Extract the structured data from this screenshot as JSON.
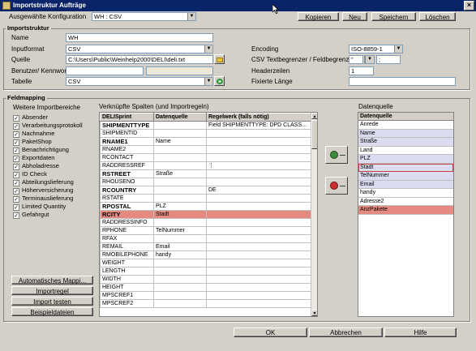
{
  "window": {
    "title": "Importstruktur Aufträge",
    "close_glyph": "×"
  },
  "top": {
    "config_label": "Ausgewählte Konfiguration",
    "config_value": "WH : CSV",
    "btn_copy": "Kopieren",
    "btn_new": "Neu",
    "btn_save": "Speichern",
    "btn_delete": "Löschen"
  },
  "importstruktur": {
    "group_label": "Importstruktur",
    "name_label": "Name",
    "name_value": "WH",
    "format_label": "Inputformat",
    "format_value": "CSV",
    "source_label": "Quelle",
    "source_value": "C:\\Users\\Public\\Weinhelp2000\\DELI\\deli.txt",
    "user_label": "Benutzer/ Kennwort",
    "user_value": "",
    "password_value": "",
    "table_label": "Tabelle",
    "table_value": "CSV",
    "encoding_label": "Encoding",
    "encoding_value": "ISO-8859-1",
    "delim_label": "CSV Textbegrenzer / Feldbegrenzer",
    "delim_text_value": "\"",
    "delim_field_value": ";",
    "header_label": "Headerzeilen",
    "header_value": "1",
    "fixed_label": "Fixierte Länge",
    "fixed_value": ""
  },
  "feldmapping": {
    "group_label": "Feldmapping",
    "further_label": "Weitere Importbereiche",
    "checkboxes": [
      {
        "label": "Absender",
        "checked": true
      },
      {
        "label": "Verarbeitungsprotokoll",
        "checked": true
      },
      {
        "label": "Nachnahme",
        "checked": true
      },
      {
        "label": "PaketShop",
        "checked": true
      },
      {
        "label": "Benachrichtigung",
        "checked": true
      },
      {
        "label": "Exportdaten",
        "checked": true
      },
      {
        "label": "Abholadresse",
        "checked": true
      },
      {
        "label": "ID Check",
        "checked": true
      },
      {
        "label": "Abteilungslieferung",
        "checked": true
      },
      {
        "label": "Höherversicherung",
        "checked": true
      },
      {
        "label": "Terminauslieferung",
        "checked": true
      },
      {
        "label": "Limited Quantity",
        "checked": true
      },
      {
        "label": "Gefahrgut",
        "checked": true
      }
    ],
    "btn_auto_mapping": "Automatisches Mappi...",
    "btn_import_rule": "Importregel",
    "btn_import_test": "Import testen",
    "btn_sample_files": "Beispieldateien",
    "linked_label": "Verknüpfte Spalten (und Importregeln)",
    "columns": [
      "DELISprint",
      "Datenquelle",
      "Regelwerk (falls nötig)"
    ],
    "rows": [
      {
        "c0": "SHIPMENTTYPE",
        "c1": "",
        "c2": "Field SHIPMENTTYPE: DPD CLASS...",
        "bold": true,
        "hl": false
      },
      {
        "c0": "SHIPMENTID",
        "c1": "",
        "c2": "",
        "bold": false,
        "hl": false
      },
      {
        "c0": "RNAME1",
        "c1": "Name",
        "c2": "",
        "bold": true,
        "hl": false
      },
      {
        "c0": "RNAME2",
        "c1": "",
        "c2": "",
        "bold": false,
        "hl": false
      },
      {
        "c0": "RCONTACT",
        "c1": "",
        "c2": "",
        "bold": false,
        "hl": false
      },
      {
        "c0": "RADDRESSREF",
        "c1": "",
        "c2": "⋮",
        "bold": false,
        "hl": false
      },
      {
        "c0": "RSTREET",
        "c1": "Straße",
        "c2": "",
        "bold": true,
        "hl": false
      },
      {
        "c0": "RHOUSENO",
        "c1": "",
        "c2": "",
        "bold": false,
        "hl": false
      },
      {
        "c0": "RCOUNTRY",
        "c1": "",
        "c2": "DE",
        "bold": true,
        "hl": false
      },
      {
        "c0": "RSTATE",
        "c1": "",
        "c2": "",
        "bold": false,
        "hl": false
      },
      {
        "c0": "RPOSTAL",
        "c1": "PLZ",
        "c2": "",
        "bold": true,
        "hl": false
      },
      {
        "c0": "RCITY",
        "c1": "Stadt",
        "c2": "",
        "bold": true,
        "hl": true
      },
      {
        "c0": "RADDRESSINFO",
        "c1": "",
        "c2": "",
        "bold": false,
        "hl": false
      },
      {
        "c0": "RPHONE",
        "c1": "TelNummer",
        "c2": "",
        "bold": false,
        "hl": false
      },
      {
        "c0": "RFAX",
        "c1": "",
        "c2": "",
        "bold": false,
        "hl": false
      },
      {
        "c0": "REMAIL",
        "c1": "Email",
        "c2": "",
        "bold": false,
        "hl": false
      },
      {
        "c0": "RMOBILEPHONE",
        "c1": "handy",
        "c2": "",
        "bold": false,
        "hl": false
      },
      {
        "c0": "WEIGHT",
        "c1": "",
        "c2": "",
        "bold": false,
        "hl": false
      },
      {
        "c0": "LENGTH",
        "c1": "",
        "c2": "",
        "bold": false,
        "hl": false
      },
      {
        "c0": "WIDTH",
        "c1": "",
        "c2": "",
        "bold": false,
        "hl": false
      },
      {
        "c0": "HEIGHT",
        "c1": "",
        "c2": "",
        "bold": false,
        "hl": false
      },
      {
        "c0": "MPSCREF1",
        "c1": "",
        "c2": "",
        "bold": false,
        "hl": false
      },
      {
        "c0": "MPSCREF2",
        "c1": "",
        "c2": "",
        "bold": false,
        "hl": false
      }
    ],
    "link_icon": "add-link-icon",
    "unlink_icon": "remove-link-icon",
    "datasource_label": "Datenquelle",
    "datasource_header": "Datenquelle",
    "datasource": [
      {
        "label": "Anrede",
        "state": "white"
      },
      {
        "label": "Name",
        "state": "blue"
      },
      {
        "label": "Straße",
        "state": "blue"
      },
      {
        "label": "Land",
        "state": "white"
      },
      {
        "label": "PLZ",
        "state": "blue"
      },
      {
        "label": "Stadt",
        "state": "sel"
      },
      {
        "label": "TelNummer",
        "state": "blue"
      },
      {
        "label": "Email",
        "state": "blue"
      },
      {
        "label": "handy",
        "state": "white"
      },
      {
        "label": "Adresse2",
        "state": "white"
      },
      {
        "label": "AnzPakete",
        "state": "red"
      }
    ]
  },
  "footer": {
    "btn_ok": "OK",
    "btn_cancel": "Abbrechen",
    "btn_help": "Hilfe"
  },
  "colors": {
    "titlebar": "#0a246a",
    "highlight": "#e48a80",
    "mapped": "#dcdcf0"
  }
}
